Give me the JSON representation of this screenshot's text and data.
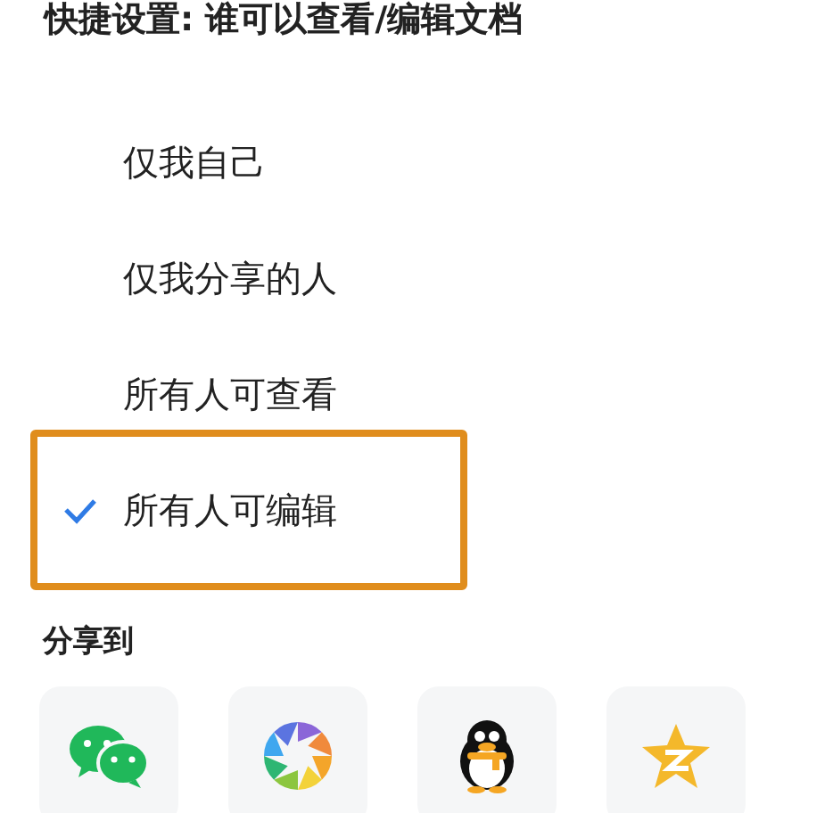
{
  "settings": {
    "title": "快捷设置: 谁可以查看/编辑文档",
    "options": [
      {
        "label": "仅我自己",
        "selected": false
      },
      {
        "label": "仅我分享的人",
        "selected": false
      },
      {
        "label": "所有人可查看",
        "selected": false
      },
      {
        "label": "所有人可编辑",
        "selected": true
      }
    ]
  },
  "share": {
    "title": "分享到",
    "targets": [
      {
        "kind": "chat"
      },
      {
        "kind": "aperture"
      },
      {
        "kind": "penguin"
      },
      {
        "kind": "star"
      }
    ]
  }
}
